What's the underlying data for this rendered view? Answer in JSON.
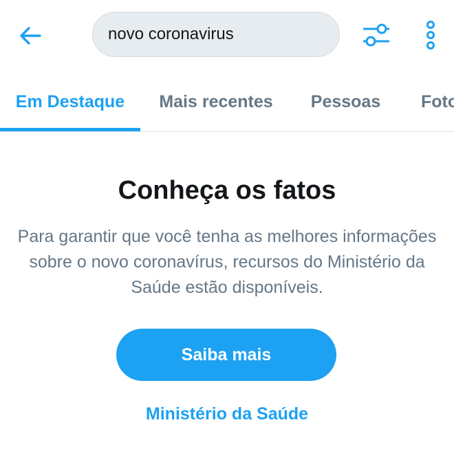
{
  "colors": {
    "accent": "#1da1f2",
    "text_primary": "#14171a",
    "text_secondary": "#657786",
    "search_bg": "#e6ecf0"
  },
  "header": {
    "back_icon": "arrow-left-icon",
    "search": {
      "value": "novo coronavirus",
      "icon": "none"
    },
    "filter_icon": "sliders-icon",
    "more_icon": "more-vertical-icon"
  },
  "tabs": [
    {
      "label": "Em Destaque",
      "active": true
    },
    {
      "label": "Mais recentes",
      "active": false
    },
    {
      "label": "Pessoas",
      "active": false
    },
    {
      "label": "Fotos",
      "active": false
    }
  ],
  "notice": {
    "title": "Conheça os fatos",
    "description": "Para garantir que você tenha as melhores informações sobre o novo coronavírus, recursos do Ministério da Saúde estão disponíveis.",
    "button_label": "Saiba mais",
    "link_label": "Ministério da Saúde"
  }
}
